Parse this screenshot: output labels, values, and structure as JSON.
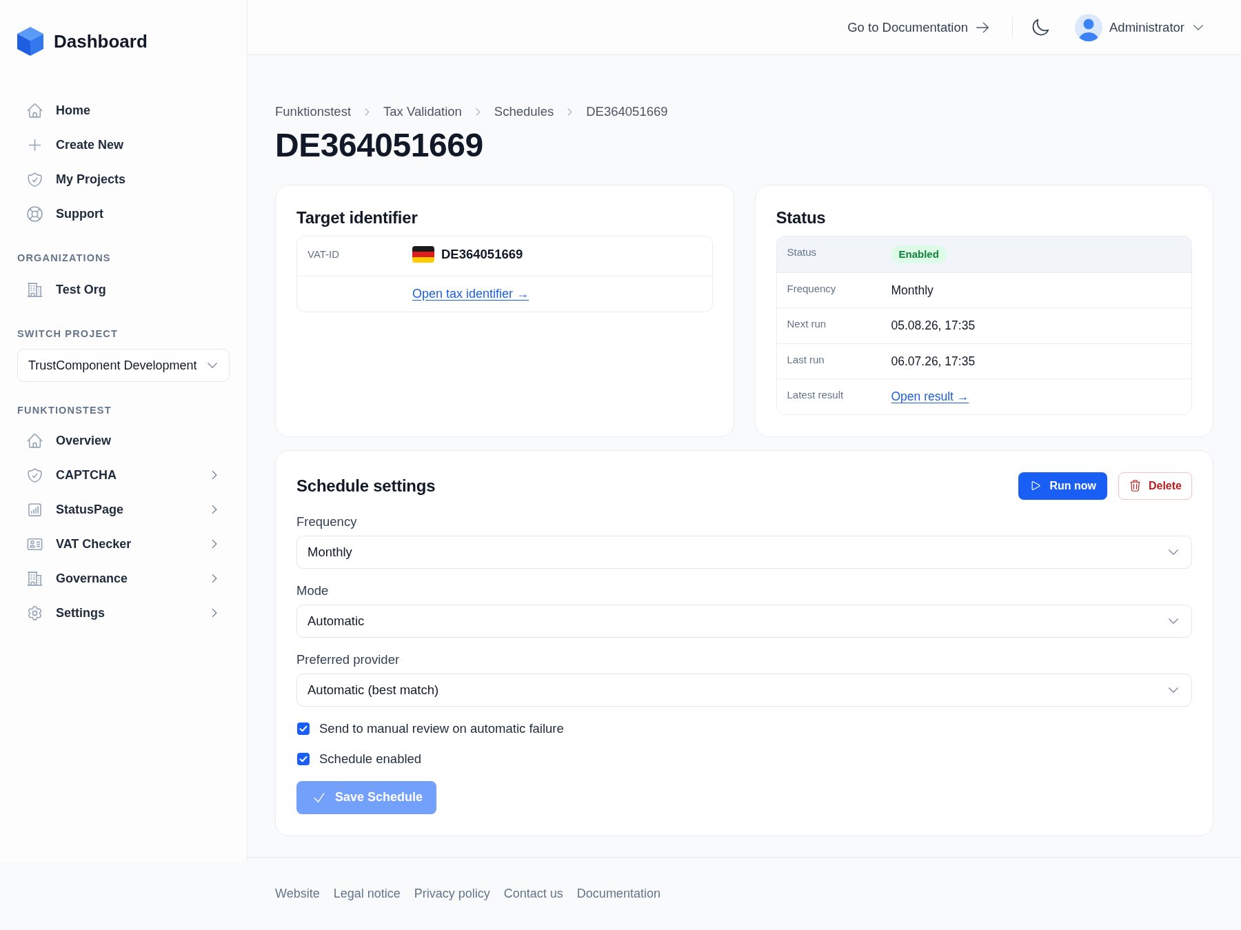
{
  "sidebar": {
    "brand": "Dashboard",
    "main_nav": [
      {
        "label": "Home"
      },
      {
        "label": "Create New"
      },
      {
        "label": "My Projects"
      },
      {
        "label": "Support"
      }
    ],
    "organizations": {
      "heading": "ORGANIZATIONS",
      "items": [
        {
          "label": "Test Org"
        }
      ]
    },
    "project_switch": {
      "heading": "SWITCH PROJECT",
      "value": "TrustComponent Development"
    },
    "project_nav": {
      "heading": "FUNKTIONSTEST",
      "items": [
        {
          "label": "Overview",
          "submenu": false
        },
        {
          "label": "CAPTCHA",
          "submenu": true
        },
        {
          "label": "StatusPage",
          "submenu": true
        },
        {
          "label": "VAT Checker",
          "submenu": true
        },
        {
          "label": "Governance",
          "submenu": true
        },
        {
          "label": "Settings",
          "submenu": true
        }
      ]
    }
  },
  "header": {
    "docs_link": "Go to Documentation",
    "user_name": "Administrator"
  },
  "breadcrumb": [
    "Funktionstest",
    "Tax Validation",
    "Schedules",
    "DE364051669"
  ],
  "title": "DE364051669",
  "target_card": {
    "title": "Target identifier",
    "rows": [
      {
        "kind": "identifier",
        "label": "VAT-ID",
        "value": "DE364051669"
      },
      {
        "kind": "link",
        "value": "Open tax identifier →"
      }
    ]
  },
  "status_card": {
    "title": "Status",
    "rows": [
      {
        "kind": "badge",
        "label": "Status",
        "value": "Enabled",
        "highlighted": true
      },
      {
        "kind": "text",
        "label": "Frequency",
        "value": "Monthly",
        "highlighted": false
      },
      {
        "kind": "text",
        "label": "Next run",
        "value": "05.08.26, 17:35",
        "highlighted": false
      },
      {
        "kind": "text",
        "label": "Last run",
        "value": "06.07.26, 17:35",
        "highlighted": false
      },
      {
        "kind": "link",
        "label": "Latest result",
        "value": "Open result →",
        "highlighted": false
      }
    ]
  },
  "schedule_settings": {
    "title": "Schedule settings",
    "actions": [
      {
        "kind": "primary",
        "label": "Run now"
      },
      {
        "kind": "danger",
        "label": "Delete"
      }
    ],
    "fields": [
      {
        "label": "Frequency",
        "value": "Monthly"
      },
      {
        "label": "Mode",
        "value": "Automatic"
      },
      {
        "label": "Preferred provider",
        "value": "Automatic (best match)"
      }
    ],
    "checkboxes": [
      {
        "label": "Send to manual review on automatic failure",
        "checked": true
      },
      {
        "label": "Schedule enabled",
        "checked": true
      }
    ],
    "save_button": {
      "label": "Save Schedule",
      "disabled": true
    }
  },
  "footer": {
    "links": [
      "Website",
      "Legal notice",
      "Privacy policy",
      "Contact us",
      "Documentation"
    ]
  }
}
